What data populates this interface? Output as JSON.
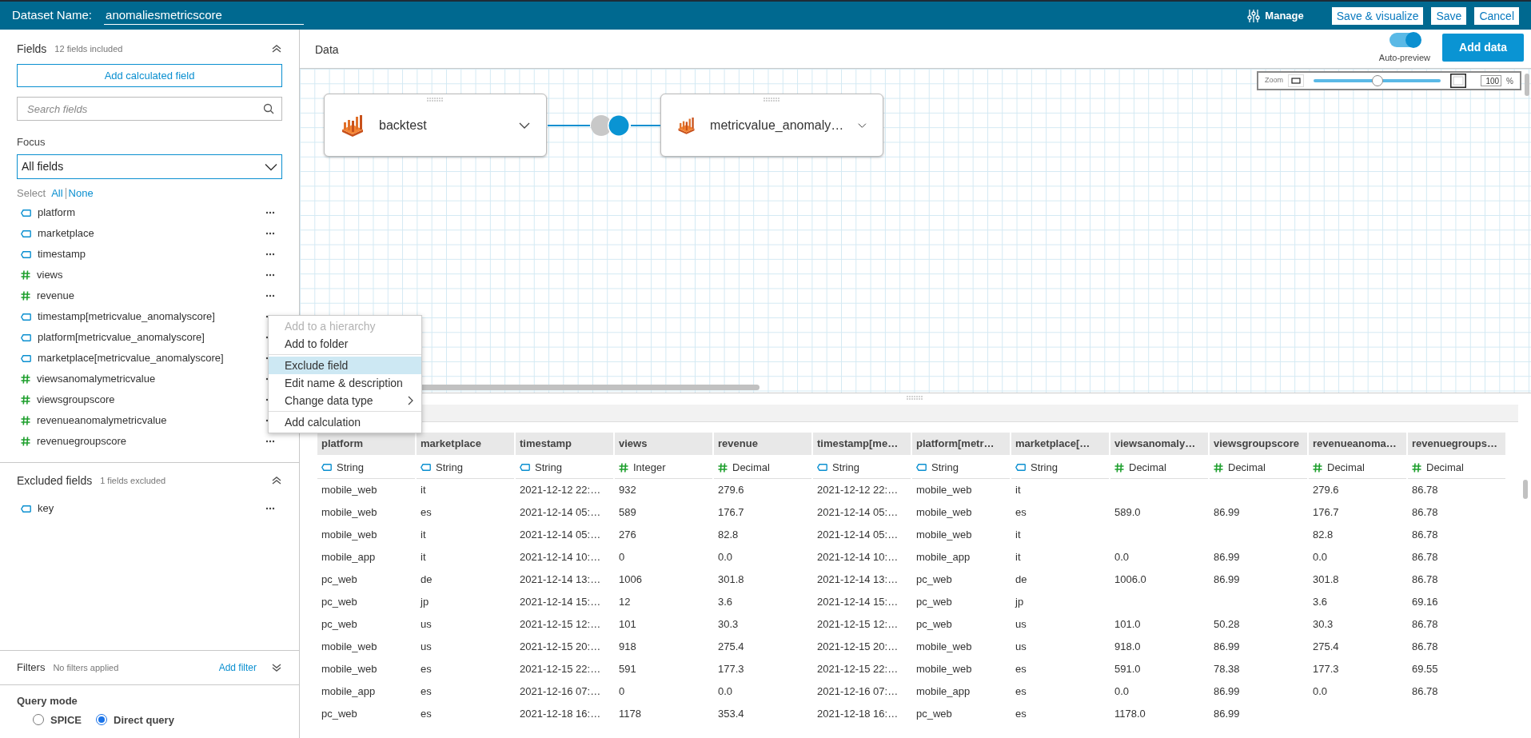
{
  "header": {
    "label": "Dataset Name:",
    "dataset_name": "anomaliesmetricscore",
    "manage": "Manage",
    "buttons": [
      "Save & visualize",
      "Save",
      "Cancel"
    ]
  },
  "fields_panel": {
    "title": "Fields",
    "summary": "12 fields included",
    "add_button": "Add calculated field",
    "search": {
      "placeholder": "Search fields"
    },
    "focus_label": "Focus",
    "focus_value": "All fields",
    "select_label": "Select",
    "select_links": [
      "All",
      "None"
    ],
    "fields": [
      {
        "name": "platform",
        "kind": "string"
      },
      {
        "name": "marketplace",
        "kind": "string"
      },
      {
        "name": "timestamp",
        "kind": "string"
      },
      {
        "name": "views",
        "kind": "number"
      },
      {
        "name": "revenue",
        "kind": "number"
      },
      {
        "name": "timestamp[metricvalue_anomalyscore]",
        "kind": "string"
      },
      {
        "name": "platform[metricvalue_anomalyscore]",
        "kind": "string"
      },
      {
        "name": "marketplace[metricvalue_anomalyscore]",
        "kind": "string"
      },
      {
        "name": "viewsanomalymetricvalue",
        "kind": "number"
      },
      {
        "name": "viewsgroupscore",
        "kind": "number"
      },
      {
        "name": "revenueanomalymetricvalue",
        "kind": "number"
      },
      {
        "name": "revenuegroupscore",
        "kind": "number"
      }
    ]
  },
  "excluded": {
    "title": "Excluded fields",
    "summary": "1 fields excluded",
    "fields": [
      {
        "name": "key",
        "kind": "string"
      }
    ]
  },
  "filters": {
    "title": "Filters",
    "summary": "No filters applied",
    "add": "Add filter"
  },
  "query_mode": {
    "title": "Query mode",
    "options": [
      {
        "label": "SPICE",
        "selected": false
      },
      {
        "label": "Direct query",
        "selected": true
      }
    ]
  },
  "context_menu": {
    "sections": [
      [
        {
          "label": "Add to a hierarchy",
          "disabled": true,
          "selected": false,
          "submenu": false
        },
        {
          "label": "Add to folder",
          "disabled": false,
          "selected": false,
          "submenu": false
        }
      ],
      [
        {
          "label": "Exclude field",
          "disabled": false,
          "selected": true,
          "submenu": false
        },
        {
          "label": "Edit name & description",
          "disabled": false,
          "selected": false,
          "submenu": false
        },
        {
          "label": "Change data type",
          "disabled": false,
          "selected": false,
          "submenu": true
        }
      ],
      [
        {
          "label": "Add calculation",
          "disabled": false,
          "selected": false,
          "submenu": false
        }
      ]
    ]
  },
  "data_panel": {
    "title": "Data",
    "auto_preview": {
      "label": "Auto-preview",
      "on": true
    },
    "add_button": "Add data",
    "zoom": {
      "label": "Zoom",
      "level": 0.5,
      "value": "100",
      "unit": "%"
    },
    "nodes": [
      {
        "name": "backtest"
      },
      {
        "name": "metricvalue_anomaly…"
      }
    ]
  },
  "table": {
    "columns": [
      {
        "name": "platform",
        "type": "String",
        "kind": "string"
      },
      {
        "name": "marketplace",
        "type": "String",
        "kind": "string"
      },
      {
        "name": "timestamp",
        "type": "String",
        "kind": "string"
      },
      {
        "name": "views",
        "type": "Integer",
        "kind": "number"
      },
      {
        "name": "revenue",
        "type": "Decimal",
        "kind": "number"
      },
      {
        "name": "timestamp[me…",
        "type": "String",
        "kind": "string"
      },
      {
        "name": "platform[metr…",
        "type": "String",
        "kind": "string"
      },
      {
        "name": "marketplace[…",
        "type": "String",
        "kind": "string"
      },
      {
        "name": "viewsanomaly…",
        "type": "Decimal",
        "kind": "number"
      },
      {
        "name": "viewsgroupscore",
        "type": "Decimal",
        "kind": "number"
      },
      {
        "name": "revenueanoma…",
        "type": "Decimal",
        "kind": "number"
      },
      {
        "name": "revenuegroups…",
        "type": "Decimal",
        "kind": "number"
      }
    ],
    "rows": [
      [
        "mobile_web",
        "it",
        "2021-12-12 22:…",
        "932",
        "279.6",
        "2021-12-12 22:…",
        "mobile_web",
        "it",
        null,
        null,
        "279.6",
        "86.78"
      ],
      [
        "mobile_web",
        "es",
        "2021-12-14 05:…",
        "589",
        "176.7",
        "2021-12-14 05:…",
        "mobile_web",
        "es",
        "589.0",
        "86.99",
        "176.7",
        "86.78"
      ],
      [
        "mobile_web",
        "it",
        "2021-12-14 05:…",
        "276",
        "82.8",
        "2021-12-14 05:…",
        "mobile_web",
        "it",
        null,
        null,
        "82.8",
        "86.78"
      ],
      [
        "mobile_app",
        "it",
        "2021-12-14 10:…",
        "0",
        "0.0",
        "2021-12-14 10:…",
        "mobile_app",
        "it",
        "0.0",
        "86.99",
        "0.0",
        "86.78"
      ],
      [
        "pc_web",
        "de",
        "2021-12-14 13:…",
        "1006",
        "301.8",
        "2021-12-14 13:…",
        "pc_web",
        "de",
        "1006.0",
        "86.99",
        "301.8",
        "86.78"
      ],
      [
        "pc_web",
        "jp",
        "2021-12-14 15:…",
        "12",
        "3.6",
        "2021-12-14 15:…",
        "pc_web",
        "jp",
        null,
        null,
        "3.6",
        "69.16"
      ],
      [
        "pc_web",
        "us",
        "2021-12-15 12:…",
        "101",
        "30.3",
        "2021-12-15 12:…",
        "pc_web",
        "us",
        "101.0",
        "50.28",
        "30.3",
        "86.78"
      ],
      [
        "mobile_web",
        "us",
        "2021-12-15 20:…",
        "918",
        "275.4",
        "2021-12-15 20:…",
        "mobile_web",
        "us",
        "918.0",
        "86.99",
        "275.4",
        "86.78"
      ],
      [
        "mobile_web",
        "es",
        "2021-12-15 22:…",
        "591",
        "177.3",
        "2021-12-15 22:…",
        "mobile_web",
        "es",
        "591.0",
        "78.38",
        "177.3",
        "69.55"
      ],
      [
        "mobile_app",
        "es",
        "2021-12-16 07:…",
        "0",
        "0.0",
        "2021-12-16 07:…",
        "mobile_app",
        "es",
        "0.0",
        "86.99",
        "0.0",
        "86.78"
      ],
      [
        "pc_web",
        "es",
        "2021-12-18 16:…",
        "1178",
        "353.4",
        "2021-12-18 16:…",
        "pc_web",
        "es",
        "1178.0",
        "86.99",
        null,
        null
      ]
    ]
  }
}
